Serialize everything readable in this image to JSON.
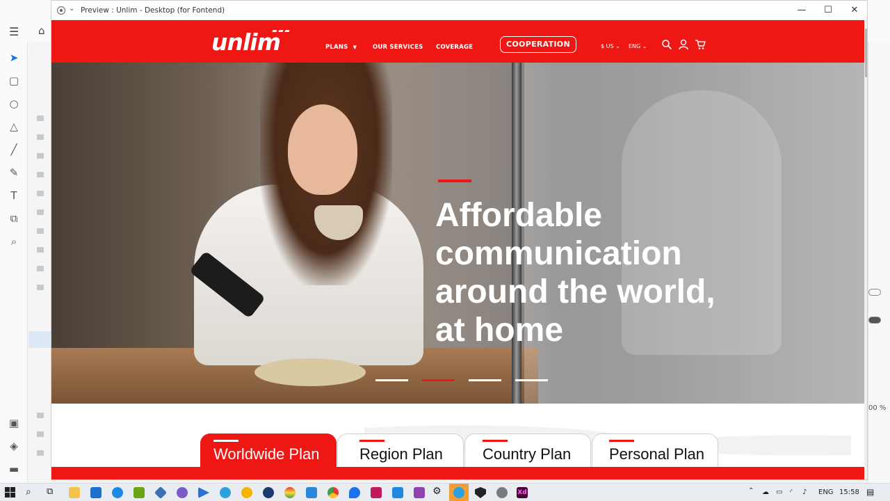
{
  "window": {
    "title": "Preview : Unlim - Desktop (for Fontend)",
    "controls": {
      "minimize": "—",
      "maximize": "☐",
      "close": "✕"
    }
  },
  "site": {
    "logo": "unlim",
    "nav": [
      {
        "label": "PLANS",
        "has_dropdown": true
      },
      {
        "label": "OUR SERVICES"
      },
      {
        "label": "COVERAGE"
      }
    ],
    "cta": "COOPERATION",
    "currency": "$ US",
    "language": "ENG",
    "icons": [
      "search-icon",
      "user-icon",
      "cart-icon"
    ],
    "brand_color": "#ef1714"
  },
  "hero": {
    "headline": [
      "Affordable",
      "communication",
      "around the world,",
      "at home"
    ],
    "slides_total": 4,
    "slide_active": 2
  },
  "plans": {
    "tabs": [
      {
        "label": "Worldwide Plan",
        "active": true
      },
      {
        "label": "Region Plan",
        "active": false
      },
      {
        "label": "Country Plan",
        "active": false
      },
      {
        "label": "Personal Plan",
        "active": false
      }
    ]
  },
  "xd": {
    "zoom": "00 %"
  },
  "taskbar": {
    "language": "ENG",
    "time": "15:58",
    "apps": [
      "file-explorer-icon",
      "mail-icon",
      "edge-icon",
      "nvidia-icon",
      "sourcetree-icon",
      "obs-icon",
      "media-player-icon",
      "telegram-icon",
      "norton-icon",
      "steam-icon",
      "chrome-canary-icon",
      "azure-icon",
      "chrome-icon",
      "maps-icon",
      "slack-icon",
      "vscode-icon",
      "twitch-icon",
      "settings-icon",
      "telegram-active-icon",
      "security-icon",
      "fingerprint-icon",
      "adobe-xd-icon"
    ]
  }
}
